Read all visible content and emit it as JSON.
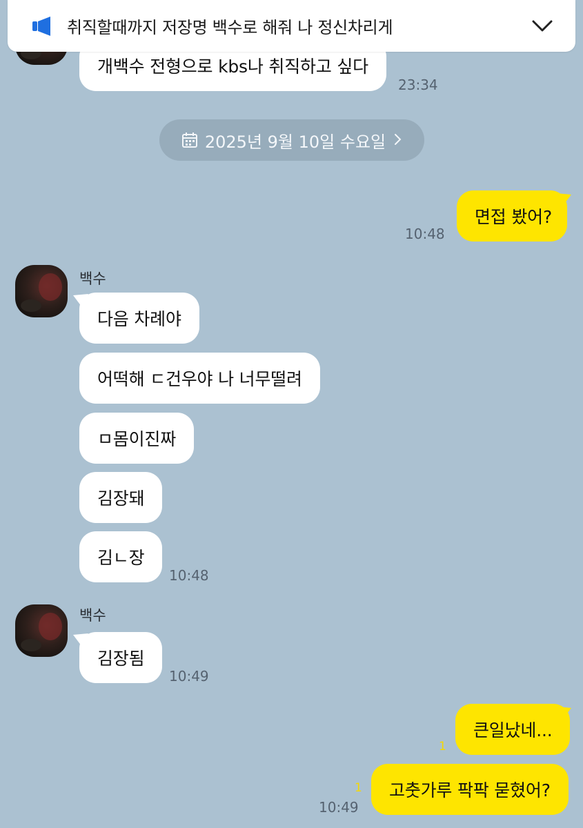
{
  "notice": {
    "text": "취직할때까지 저장명 백수로 해줘 나 정신차리게",
    "icon": "megaphone-icon",
    "accent": "#1f6fe0"
  },
  "date_divider": {
    "label": "2025년 9월 10일 수요일"
  },
  "messages": {
    "m0": {
      "text": "개백수 전형으로 kbs나 취직하고 싶다",
      "time": "23:34"
    },
    "m1": {
      "text": "면접 봤어?",
      "time": "10:48"
    },
    "sender1": "백수",
    "m2": {
      "text": "다음 차례야"
    },
    "m3": {
      "text": "어떡해 ㄷ건우야 나 너무떨려"
    },
    "m4": {
      "text": "ㅁ몸이진짜"
    },
    "m5": {
      "text": "김장돼"
    },
    "m6": {
      "text": "김ㄴ장",
      "time": "10:48"
    },
    "sender2": "백수",
    "m7": {
      "text": "김장됨",
      "time": "10:49"
    },
    "m8": {
      "text": "큰일났네...",
      "unread": "1"
    },
    "m9": {
      "text": "고춧가루 팍팍 묻혔어?",
      "unread": "1",
      "time": "10:49"
    }
  },
  "colors": {
    "background": "#abc1d1",
    "outgoing_bubble": "#fee500",
    "incoming_bubble": "#ffffff"
  }
}
